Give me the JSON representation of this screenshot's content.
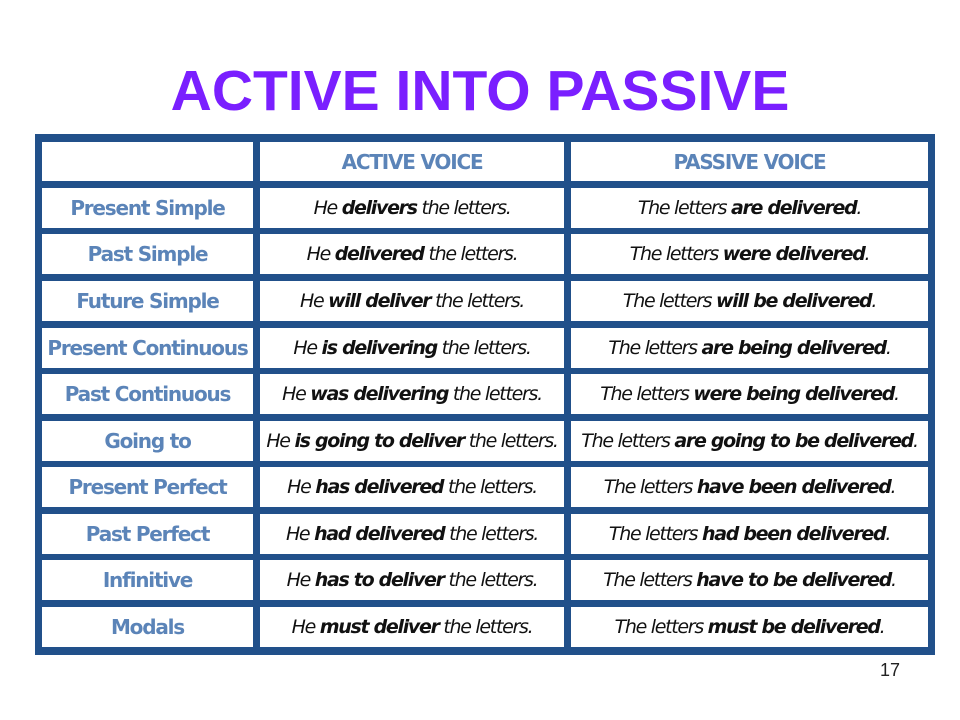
{
  "title": "ACTIVE INTO PASSIVE",
  "page_number": "17",
  "colors": {
    "title": "#7a1fff",
    "table_border": "#21508a",
    "label_text": "#5b84b8"
  },
  "table": {
    "headers": [
      "",
      "ACTIVE VOICE",
      "PASSIVE VOICE"
    ],
    "rows": [
      {
        "tense": "Present Simple",
        "active": {
          "pre": "He ",
          "bold": "delivers",
          "post": " the letters."
        },
        "passive": {
          "pre": "The letters ",
          "bold": "are delivered",
          "post": "."
        }
      },
      {
        "tense": "Past Simple",
        "active": {
          "pre": "He ",
          "bold": "delivered",
          "post": " the letters."
        },
        "passive": {
          "pre": "The letters ",
          "bold": "were delivered",
          "post": "."
        }
      },
      {
        "tense": "Future Simple",
        "active": {
          "pre": "He ",
          "bold": "will deliver",
          "post": " the letters."
        },
        "passive": {
          "pre": "The letters ",
          "bold": "will be delivered",
          "post": "."
        }
      },
      {
        "tense": "Present Continuous",
        "active": {
          "pre": "He ",
          "bold": "is delivering",
          "post": " the letters."
        },
        "passive": {
          "pre": "The letters ",
          "bold": "are being delivered",
          "post": "."
        }
      },
      {
        "tense": "Past Continuous",
        "active": {
          "pre": "He ",
          "bold": "was delivering",
          "post": " the letters."
        },
        "passive": {
          "pre": "The letters ",
          "bold": "were being delivered",
          "post": "."
        }
      },
      {
        "tense": "Going to",
        "active": {
          "pre": "He ",
          "bold": "is going to deliver",
          "post": " the letters."
        },
        "passive": {
          "pre": "The letters ",
          "bold": "are going to be delivered",
          "post": "."
        }
      },
      {
        "tense": "Present Perfect",
        "active": {
          "pre": "He ",
          "bold": "has delivered",
          "post": " the letters."
        },
        "passive": {
          "pre": "The letters ",
          "bold": "have been delivered",
          "post": "."
        }
      },
      {
        "tense": "Past Perfect",
        "active": {
          "pre": "He ",
          "bold": "had delivered",
          "post": " the letters."
        },
        "passive": {
          "pre": "The letters ",
          "bold": "had been delivered",
          "post": "."
        }
      },
      {
        "tense": "Infinitive",
        "active": {
          "pre": "He ",
          "bold": "has to deliver",
          "post": " the letters."
        },
        "passive": {
          "pre": "The letters ",
          "bold": "have to be delivered",
          "post": "."
        }
      },
      {
        "tense": "Modals",
        "active": {
          "pre": "He ",
          "bold": "must deliver",
          "post": " the letters."
        },
        "passive": {
          "pre": "The letters ",
          "bold": "must be delivered",
          "post": "."
        }
      }
    ]
  }
}
